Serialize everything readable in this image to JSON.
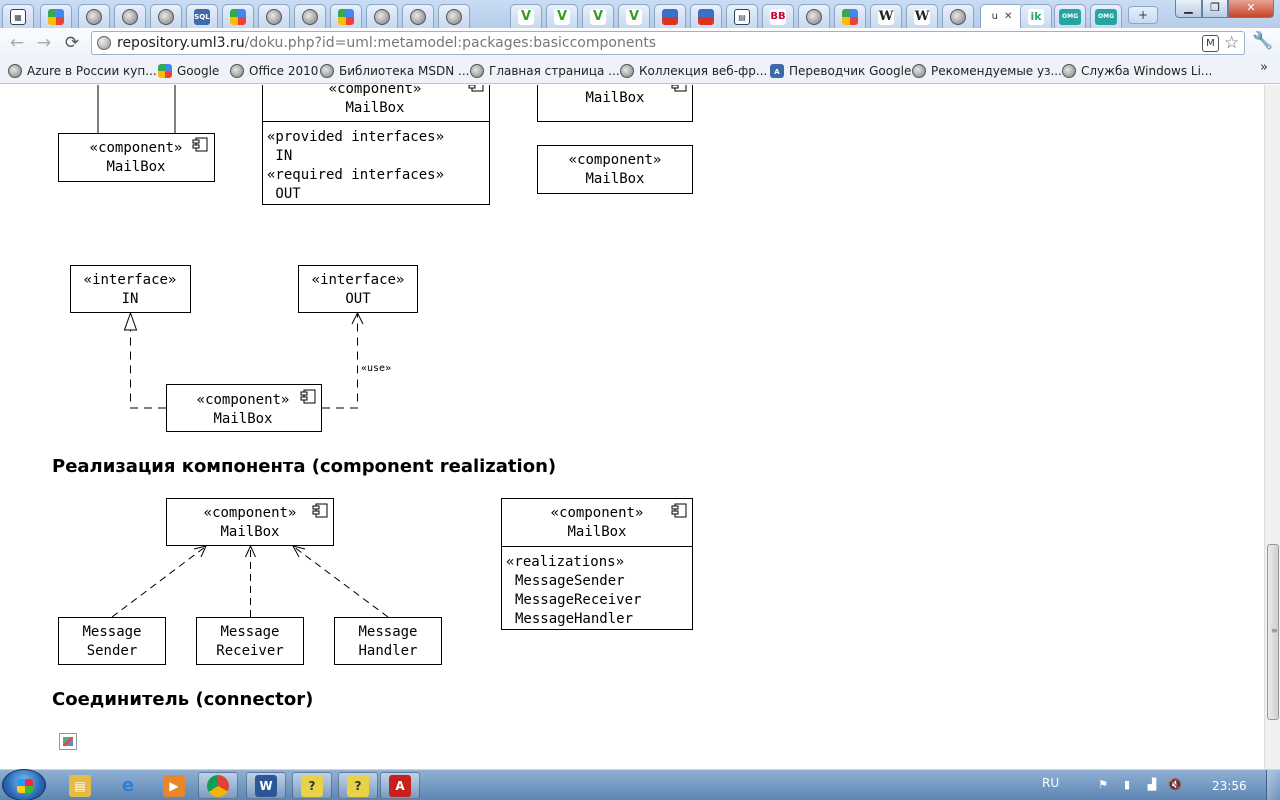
{
  "browser": {
    "address": {
      "host": "repository.uml3.ru",
      "path": "/doku.php?id=uml:metamodel:packages:basiccomponents"
    },
    "active_tab_label": "u",
    "new_tab_symbol": "+",
    "bookmarks": [
      {
        "label": "Azure в России куп...",
        "icon": "globe-icon"
      },
      {
        "label": "Google",
        "icon": "google-icon"
      },
      {
        "label": "Office 2010",
        "icon": "globe-icon"
      },
      {
        "label": "Библиотека MSDN ...",
        "icon": "globe-icon"
      },
      {
        "label": "Главная страница ...",
        "icon": "globe-icon"
      },
      {
        "label": "Коллекция веб-фр...",
        "icon": "globe-icon"
      },
      {
        "label": "Переводчик Google",
        "icon": "translate-icon"
      },
      {
        "label": "Рекомендуемые уз...",
        "icon": "globe-icon"
      },
      {
        "label": "Служба Windows Li...",
        "icon": "globe-icon"
      }
    ],
    "bookmarks_more": "»"
  },
  "diagram_top": {
    "left_component": {
      "stereotype": "«component»",
      "name": "MailBox"
    },
    "middle_component": {
      "stereotype": "«component»",
      "name": "MailBox",
      "lines": [
        "«provided interfaces»",
        " IN",
        "«required interfaces»",
        " OUT"
      ]
    },
    "right_box_1": {
      "name": "MailBox"
    },
    "right_box_2": {
      "stereotype": "«component»",
      "name": "MailBox"
    }
  },
  "diagram_interfaces": {
    "iface_in": {
      "stereotype": "«interface»",
      "name": "IN"
    },
    "iface_out": {
      "stereotype": "«interface»",
      "name": "OUT"
    },
    "use_label": "«use»",
    "component": {
      "stereotype": "«component»",
      "name": "MailBox"
    }
  },
  "section_realization": {
    "heading": "Реализация компонента (component realization)"
  },
  "diagram_realization": {
    "component": {
      "stereotype": "«component»",
      "name": "MailBox"
    },
    "realizers": [
      {
        "line1": "Message",
        "line2": "Sender"
      },
      {
        "line1": "Message",
        "line2": "Receiver"
      },
      {
        "line1": "Message",
        "line2": "Handler"
      }
    ],
    "compact": {
      "stereotype": "«component»",
      "name": "MailBox",
      "section": "«realizations»",
      "items": [
        "MessageSender",
        "MessageReceiver",
        "MessageHandler"
      ]
    }
  },
  "section_connector": {
    "heading": "Соединитель (connector)"
  },
  "taskbar": {
    "lang": "RU",
    "clock": "23:56",
    "colors": {
      "accent": "#5d86b3"
    }
  }
}
